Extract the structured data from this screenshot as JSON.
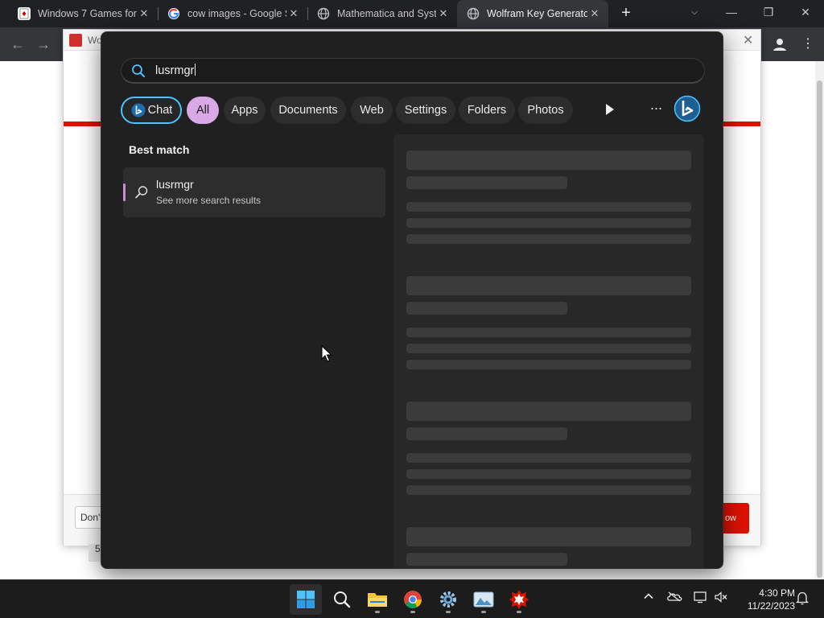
{
  "browser": {
    "tabs": [
      {
        "title": "Windows 7 Games for",
        "icon": "solitaire-icon",
        "active": false
      },
      {
        "title": "cow images - Google S",
        "icon": "google-icon",
        "active": false
      },
      {
        "title": "Mathematica and Syste",
        "icon": "globe-icon",
        "active": false
      },
      {
        "title": "Wolfram Key Generato",
        "icon": "globe-icon",
        "active": true
      }
    ],
    "window_controls": {
      "minimize": "—",
      "restore": "❐",
      "close": "✕"
    }
  },
  "background_page": {
    "dialog_title": "Wo",
    "dont_button": "Don't",
    "red_button": "ow",
    "footer_fragment": "5"
  },
  "search": {
    "query": "lusrmgr",
    "filters": [
      "Chat",
      "All",
      "Apps",
      "Documents",
      "Web",
      "Settings",
      "Folders",
      "Photos"
    ],
    "active_filter": "All",
    "best_match_heading": "Best match",
    "result": {
      "title": "lusrmgr",
      "subtitle": "See more search results"
    },
    "accent_color": "#d9a8e6",
    "chat_border_color": "#4cc2ff"
  },
  "taskbar": {
    "apps": [
      "start-icon",
      "search-icon",
      "file-explorer-icon",
      "chrome-icon",
      "settings-icon",
      "photos-app-icon",
      "wolfram-mathematica-icon"
    ],
    "tray": [
      "chevron-up-icon",
      "onedrive-icon",
      "network-icon",
      "volume-muted-icon",
      "notification-bell-icon"
    ],
    "time": "4:30 PM",
    "date": "11/22/2023"
  }
}
